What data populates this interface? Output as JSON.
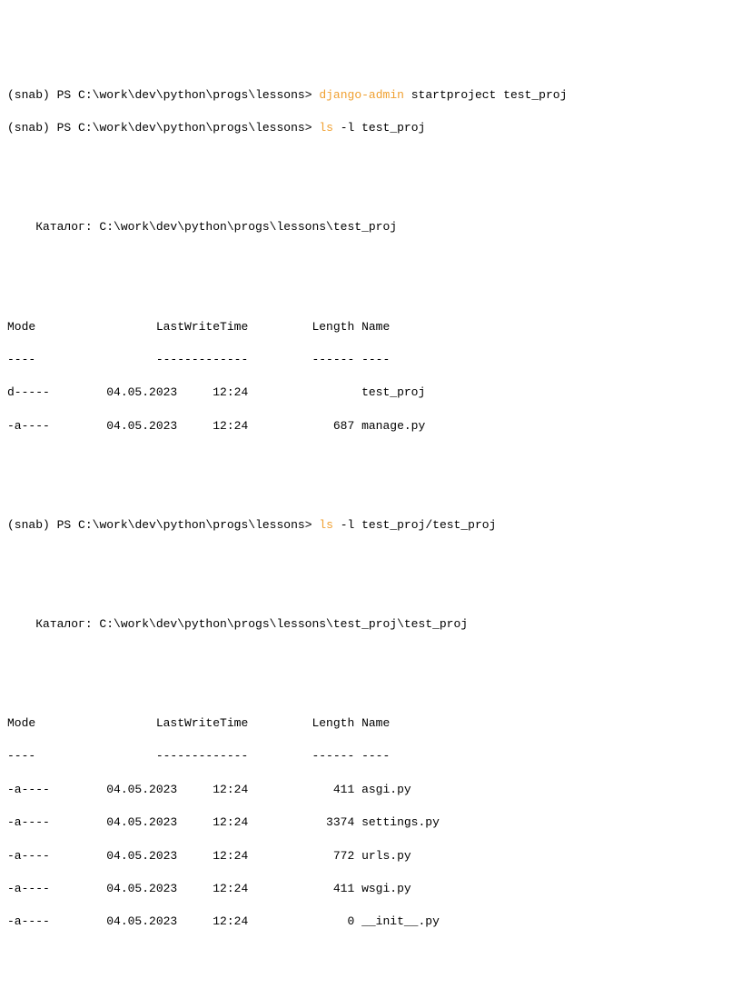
{
  "prompts": {
    "env": "(snab)",
    "shell": "PS",
    "path": "C:\\work\\dev\\python\\progs\\lessons>"
  },
  "cmd1": {
    "highlight": "django-admin",
    "rest": " startproject test_proj"
  },
  "cmd2": {
    "highlight": "ls",
    "rest": " -l test_proj"
  },
  "cmd3": {
    "highlight": "ls",
    "rest": " -l test_proj/test_proj"
  },
  "listing1": {
    "dirLabel": "    Каталог: C:\\work\\dev\\python\\progs\\lessons\\test_proj",
    "header": "Mode                 LastWriteTime         Length Name",
    "divider": "----                 -------------         ------ ----",
    "rows": [
      "d-----        04.05.2023     12:24                test_proj",
      "-a----        04.05.2023     12:24            687 manage.py"
    ]
  },
  "listing2": {
    "dirLabel": "    Каталог: C:\\work\\dev\\python\\progs\\lessons\\test_proj\\test_proj",
    "header": "Mode                 LastWriteTime         Length Name",
    "divider": "----                 -------------         ------ ----",
    "rows": [
      "-a----        04.05.2023     12:24            411 asgi.py",
      "-a----        04.05.2023     12:24           3374 settings.py",
      "-a----        04.05.2023     12:24            772 urls.py",
      "-a----        04.05.2023     12:24            411 wsgi.py",
      "-a----        04.05.2023     12:24              0 __init__.py"
    ]
  },
  "chart_data": {
    "type": "table",
    "tables": [
      {
        "title": "C:\\work\\dev\\python\\progs\\lessons\\test_proj",
        "columns": [
          "Mode",
          "LastWriteTime",
          "Length",
          "Name"
        ],
        "rows": [
          {
            "Mode": "d-----",
            "LastWriteTime": "04.05.2023 12:24",
            "Length": null,
            "Name": "test_proj"
          },
          {
            "Mode": "-a----",
            "LastWriteTime": "04.05.2023 12:24",
            "Length": 687,
            "Name": "manage.py"
          }
        ]
      },
      {
        "title": "C:\\work\\dev\\python\\progs\\lessons\\test_proj\\test_proj",
        "columns": [
          "Mode",
          "LastWriteTime",
          "Length",
          "Name"
        ],
        "rows": [
          {
            "Mode": "-a----",
            "LastWriteTime": "04.05.2023 12:24",
            "Length": 411,
            "Name": "asgi.py"
          },
          {
            "Mode": "-a----",
            "LastWriteTime": "04.05.2023 12:24",
            "Length": 3374,
            "Name": "settings.py"
          },
          {
            "Mode": "-a----",
            "LastWriteTime": "04.05.2023 12:24",
            "Length": 772,
            "Name": "urls.py"
          },
          {
            "Mode": "-a----",
            "LastWriteTime": "04.05.2023 12:24",
            "Length": 411,
            "Name": "wsgi.py"
          },
          {
            "Mode": "-a----",
            "LastWriteTime": "04.05.2023 12:24",
            "Length": 0,
            "Name": "__init__.py"
          }
        ]
      }
    ]
  }
}
